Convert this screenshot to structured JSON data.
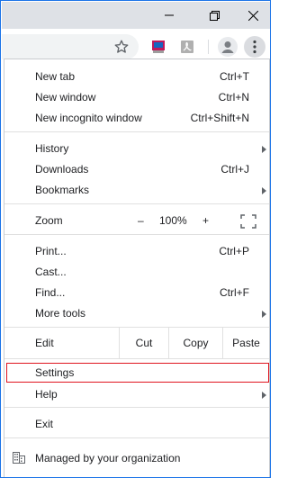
{
  "window": {
    "minimize_icon": "minimize-icon",
    "restore_icon": "restore-icon",
    "close_icon": "close-icon"
  },
  "toolbar": {
    "bookmark_icon": "star-icon",
    "extensions": [
      "extension-icon",
      "pdf-icon"
    ],
    "profile_icon": "avatar-icon",
    "menu_icon": "more-vertical-icon"
  },
  "menu": {
    "new_tab": {
      "label": "New tab",
      "shortcut": "Ctrl+T"
    },
    "new_window": {
      "label": "New window",
      "shortcut": "Ctrl+N"
    },
    "new_incognito": {
      "label": "New incognito window",
      "shortcut": "Ctrl+Shift+N"
    },
    "history": {
      "label": "History"
    },
    "downloads": {
      "label": "Downloads",
      "shortcut": "Ctrl+J"
    },
    "bookmarks": {
      "label": "Bookmarks"
    },
    "zoom": {
      "label": "Zoom",
      "minus": "–",
      "value": "100%",
      "plus": "+"
    },
    "print": {
      "label": "Print...",
      "shortcut": "Ctrl+P"
    },
    "cast": {
      "label": "Cast..."
    },
    "find": {
      "label": "Find...",
      "shortcut": "Ctrl+F"
    },
    "more_tools": {
      "label": "More tools"
    },
    "edit": {
      "label": "Edit",
      "cut": "Cut",
      "copy": "Copy",
      "paste": "Paste"
    },
    "settings": {
      "label": "Settings"
    },
    "help": {
      "label": "Help"
    },
    "exit": {
      "label": "Exit"
    },
    "managed": {
      "label": "Managed by your organization"
    }
  },
  "colors": {
    "highlight_border": "#e0141f",
    "window_border": "#1a73e8"
  }
}
